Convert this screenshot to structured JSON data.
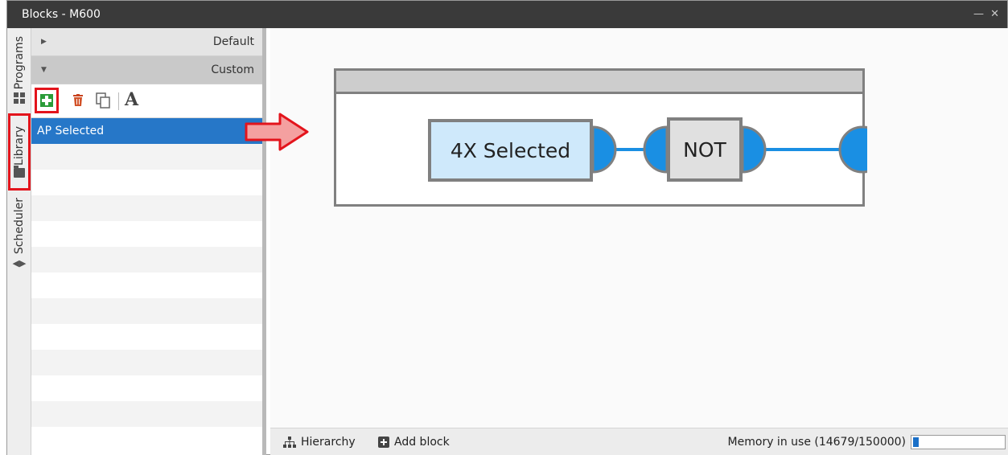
{
  "window": {
    "title": "Blocks - M600",
    "controls": "— ✕"
  },
  "vertical_tabs": [
    {
      "label": "Programs",
      "icon": "grid-icon"
    },
    {
      "label": "Library",
      "icon": "folder-icon"
    },
    {
      "label": "Scheduler",
      "icon": "arrows-icon"
    }
  ],
  "library": {
    "groups": [
      {
        "label": "Default",
        "expanded": false
      },
      {
        "label": "Custom",
        "expanded": true
      }
    ],
    "toolbar": [
      "add-icon",
      "delete-icon",
      "copy-icon",
      "font-icon"
    ],
    "font_glyph": "A",
    "items": [
      "AP Selected"
    ],
    "selected_index": 0
  },
  "diagram": {
    "nodes": [
      {
        "label": "4X Selected"
      },
      {
        "label": "NOT"
      }
    ]
  },
  "status_bar": {
    "hierarchy_label": "Hierarchy",
    "add_block_label": "Add block",
    "memory_label": "Memory in use (14679/150000)",
    "memory_fraction": 0.0979
  },
  "colors": {
    "accent_blue": "#2677c8",
    "connector_blue": "#1a8fe3",
    "highlight_red": "#e3141c"
  }
}
